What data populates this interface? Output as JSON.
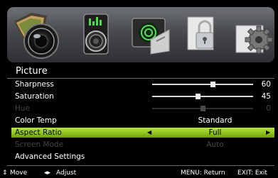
{
  "menu_title": "Picture",
  "icons": [
    "picture-icon",
    "sound-icon",
    "channel-icon",
    "lock-icon",
    "setup-icon"
  ],
  "items": [
    {
      "label": "Sharpness",
      "type": "slider",
      "value": "60",
      "level": 60,
      "enabled": true
    },
    {
      "label": "Saturation",
      "type": "slider",
      "value": "45",
      "level": 45,
      "enabled": true
    },
    {
      "label": "Hue",
      "type": "slider",
      "value": "0",
      "level": 50,
      "enabled": false
    },
    {
      "label": "Color Temp",
      "type": "option",
      "value": "Standard",
      "enabled": true
    },
    {
      "label": "Aspect Ratio",
      "type": "option",
      "value": "Full",
      "enabled": true,
      "selected": true
    },
    {
      "label": "Screen Mode",
      "type": "option",
      "value": "Auto",
      "enabled": false
    },
    {
      "label": "Advanced Settings",
      "type": "submenu",
      "enabled": true
    }
  ],
  "footer": {
    "move": "Move",
    "adjust": "Adjust",
    "menu_return": "MENU: Return",
    "exit": "EXIT: Exit"
  },
  "colors": {
    "highlight": "#9acd32",
    "background": "#000000",
    "disabled_text": "#444444"
  }
}
